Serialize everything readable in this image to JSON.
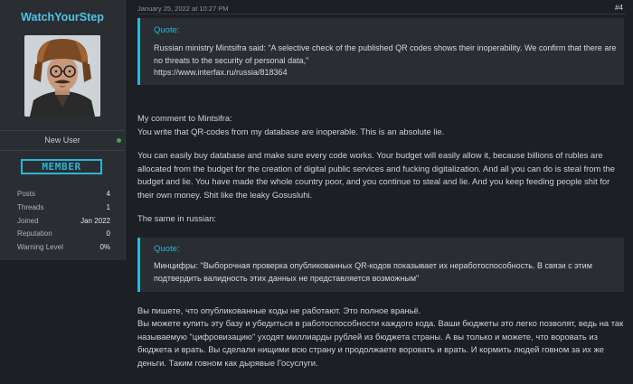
{
  "user": {
    "name": "WatchYourStep",
    "title": "New User",
    "banner": "MEMBER",
    "stats": [
      {
        "label": "Posts",
        "value": "4"
      },
      {
        "label": "Threads",
        "value": "1"
      },
      {
        "label": "Joined",
        "value": "Jan 2022"
      },
      {
        "label": "Reputation",
        "value": "0"
      },
      {
        "label": "Warning Level",
        "value": "0%"
      }
    ]
  },
  "post": {
    "date": "January 25, 2022 at 10:27 PM",
    "number": "#4",
    "quote1": {
      "label": "Quote:",
      "text": "Russian ministry Mintsifra said: “A selective check of the published QR codes shows their inoperability. We confirm that there are no threats to the security of personal data,”",
      "link": "https://www.interfax.ru/russia/818364"
    },
    "comment_intro": "My comment to Mintsifra:",
    "comment_line2": "You write that QR-codes from my database are inoperable. This is an absolute lie.",
    "comment_para": "You can easily buy database and make sure every code works. Your budget will easily allow it, because billions of rubles are allocated from the budget for the creation of digital public services and fucking digitalization. And all you can do is steal from the budget and lie. You have made the whole country poor, and you continue to steal and lie. And you keep feeding people shit for their own money. Shit like the leaky Gosusluhi.",
    "same_in_russian": "The same in russian:",
    "quote2": {
      "label": "Quote:",
      "text": "Минцифры: \"Выборочная проверка опубликованных QR-кодов показывает их неработоспособность. В связи с этим подтвердить валидность этих данных не представляется возможным\""
    },
    "russian_line1": "Вы пишете, что опубликованные коды не работают. Это полное враньё.",
    "russian_para": "Вы можете купить эту базу и убедиться в работоспособности каждого кода. Ваши бюджеты это легко позволят, ведь на так называемую \"цифровизацию\" уходят миллиарды рублей из бюджета страны. А вы только и можете, что воровать из бюджета и врать. Вы сделали нищими всю страну и продолжаете воровать и врать. И кормить людей говном за их же деньги. Таким говном как дырявые Госуслуги."
  },
  "colors": {
    "accent": "#2bb6d8",
    "username": "#4fc3e8",
    "background": "#1c1f23",
    "panel": "#2a2e33"
  }
}
